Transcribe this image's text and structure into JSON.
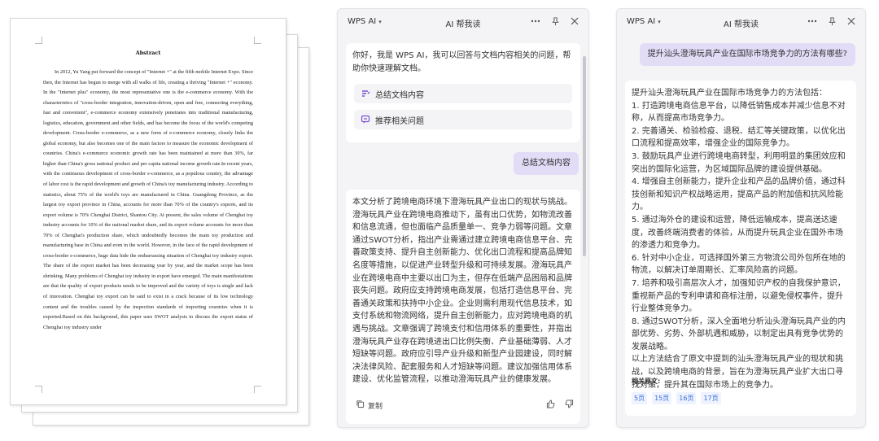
{
  "document": {
    "title": "Abstract",
    "body": "In 2012, Yu Yang put forward the concept of \"Internet +\" at the fifth mobile Internet Expo. Since then, the Internet has begun to merge with all walks of life, creating a thriving \"Internet +\" economy. In the \"Internet plus\" economy, the most representative one is the e-commerce economy. With the characteristics of \"cross-border integration, innovation-driven, open and free, connecting everything, fast and convenient\", e-commerce economy extensively penetrates into traditional manufacturing, logistics, education, government and other fields, and has become the focus of the world's competing development. Cross-border e-commerce, as a new form of e-commerce economy, closely links the global economy, but also becomes one of the main factors to measure the economic development of countries. China's e-commerce economic growth rate has been maintained at more than 30%, far higher than China's gross national product and per capita national income growth rate.In recent years, with the continuous development of cross-border e-commerce, as a populous country, the advantage of labor cost is the rapid development and growth of China's toy manufacturing industry. According to statistics, about 75% of the world's toys are manufactured in China. Guangdong Province, as the largest toy export province in China, accounts for more than 70% of the country's exports, and its export volume is 70% Chenghai District, Shantou City. At present, the sales volume of Chenghai toy industry accounts for 10% of the national market share, and its export volume accounts for more than 70% of Chenghai's production share, which undoubtedly becomes the main toy production and manufacturing base in China and even in the world. However, in the face of the rapid development of cross-border e-commerce, huge data hide the embarrassing situation of Chenghai toy industry export. The share of the export market has been decreasing year by year, and the market scope has been shrinking. Many problems of Chenghai toy industry in export have emerged. The main manifestations are that the quality of export products needs to be improved and the variety of toys is single and lack of innovation. Chenghai toy export can be said to exist in a crack because of its low technology content and the troubles caused by the inspection standards of importing countries when it is exported.Based on this background, this paper uses SWOT analysis to discuss the export status of Chenghai toy industry under"
  },
  "panel_left": {
    "brand": "WPS AI",
    "title": "AI 帮我读",
    "greeting": "你好，我是 WPS AI，我可以回答与文档内容相关的问题，帮助你快速理解文档。",
    "quick_actions": [
      "总结文档内容",
      "推荐相关问题"
    ],
    "user_message": "总结文档内容",
    "answer": "本文分析了跨境电商环境下澄海玩具产业出口的现状与挑战。澄海玩具产业在跨境电商推动下，虽有出口优势，如物流改善和信息流通，但也面临产品质量单一、竞争力弱等问题。文章通过SWOT分析，指出产业需通过建立跨境电商信息平台、完善政策支持、提升自主创新能力、优化出口流程和提高品牌知名度等措施，以促进产业转型升级和可持续发展。澄海玩具产业在跨境电商中主要以出口为主，但存在低端产品困局和品牌丧失问题。政府应支持跨境电商发展，包括打造信息平台、完善通关政策和扶持中小企业。企业则需利用现代信息技术，如支付系统和物流网络，提升自主创新能力，应对跨境电商的机遇与挑战。文章强调了跨境支付和信用体系的重要性，并指出澄海玩具产业存在跨境进出口比例失衡、产业基础薄弱、人才短缺等问题。政府应引导产业升级和新型产业园建设，同时解决法律风险、配套服务和人才短缺等问题。建议加强信用体系建设、优化监管流程，以推动澄海玩具产业的健康发展。",
    "copy_label": "复制"
  },
  "panel_right": {
    "brand": "WPS AI",
    "title": "AI 帮我读",
    "user_message": "提升汕头澄海玩具产业在国际市场竞争力的方法有哪些?",
    "answer_lines": [
      "提升汕头澄海玩具产业在国际市场竞争力的方法包括：",
      "1. 打造跨境电商信息平台，以降低销售成本并减少信息不对称，从而提高市场竞争力。",
      "2. 完善通关、检验检疫、退税、结汇等关键政策，以优化出口流程和提高效率，增强企业的国际竞争力。",
      "3. 鼓励玩具产业进行跨境电商转型，利用明显的集团效应和突出的国际化运营，为区域国际品牌的建设提供基础。",
      "4. 增强自主创新能力，提升企业和产品的品牌价值，通过科技创新和知识产权战略运用，提高产品的附加值和抗风险能力。",
      "5. 通过海外仓的建设和运营，降低运输成本，提高送达速度，改善终端消费者的体验，从而提升玩具企业在国外市场的渗透力和竞争力。",
      "6. 针对中小企业，可选择国外第三方物流公司外包所在地的物流，以解决订单周期长、汇率风险高的问题。",
      "7. 培养和吸引高层次人才，加强知识产权的自我保护意识，重视新产品的专利申请和商标注册，以避免侵权事件，提升行业整体竞争力。",
      "8. 通过SWOT分析，深入全面地分析汕头澄海玩具产业的内部优势、劣势、外部机遇和威胁，以制定出具有竞争优势的发展战略。",
      "以上方法结合了原文中提到的汕头澄海玩具产业的现状和挑战，以及跨境电商的背景，旨在为澄海玩具产业扩大出口寻找对策，提升其在国际市场上的竞争力。"
    ],
    "related_label": "相关原文:",
    "related_pages": [
      "5页",
      "15页",
      "16页",
      "17页"
    ]
  },
  "colors": {
    "user_bubble": "#e2dcf7",
    "accent": "#7a4fd6",
    "link": "#3c6fd9",
    "panel_bg": "#f4f4f6"
  },
  "icons": [
    "more-icon",
    "pin-icon",
    "close-icon",
    "summary-icon",
    "suggest-icon",
    "copy-icon",
    "thumbs-up-icon",
    "thumbs-down-icon"
  ]
}
